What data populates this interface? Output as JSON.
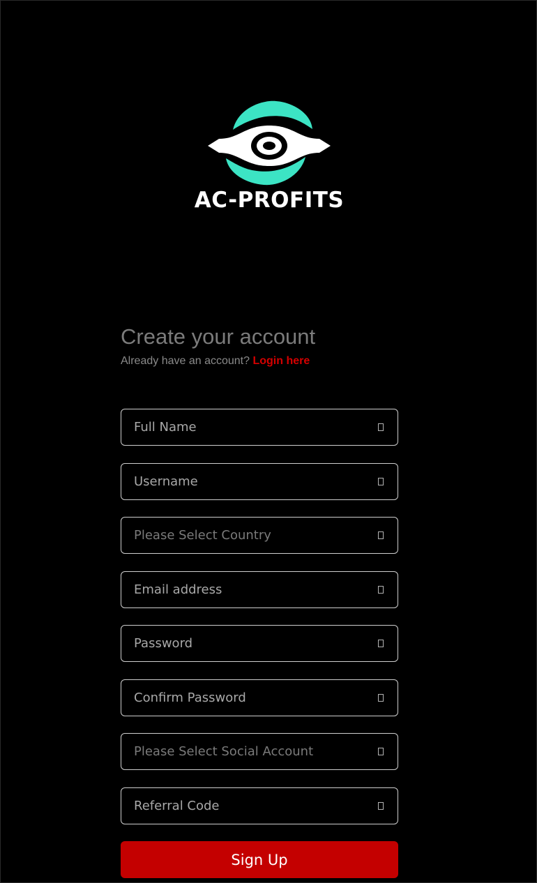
{
  "brand": {
    "name": "AC-PROFITS",
    "colors": {
      "accent": "#3ce4c4",
      "white": "#ffffff"
    }
  },
  "header": {
    "title": "Create your account",
    "subtitle_prefix": "Already have an account?",
    "login_link": "Login here"
  },
  "form": {
    "full_name": {
      "placeholder": "Full Name",
      "icon": "user-icon"
    },
    "username": {
      "placeholder": "Username",
      "icon": "user-icon"
    },
    "country": {
      "placeholder": "Please Select Country",
      "icon": "globe-icon"
    },
    "email": {
      "placeholder": "Email address",
      "icon": "envelope-icon"
    },
    "password": {
      "placeholder": "Password",
      "icon": "lock-icon"
    },
    "confirm_password": {
      "placeholder": "Confirm Password",
      "icon": "lock-icon"
    },
    "social": {
      "placeholder": "Please Select Social Account",
      "icon": "share-icon"
    },
    "referral": {
      "placeholder": "Referral Code",
      "icon": "tag-icon"
    },
    "submit_label": "Sign Up"
  },
  "colors": {
    "background": "#000000",
    "button": "#c40000",
    "link": "#d40000",
    "input_border": "#cfcfcf"
  }
}
